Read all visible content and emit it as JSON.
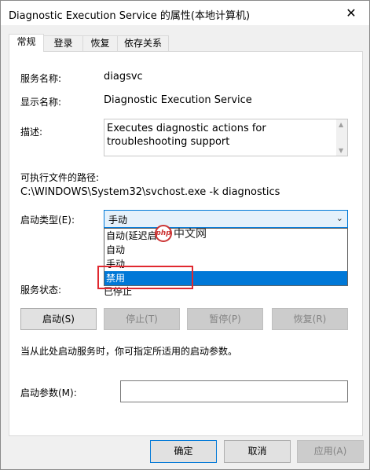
{
  "window": {
    "title": "Diagnostic Execution Service 的属性(本地计算机)",
    "close_glyph": "✕"
  },
  "tabs": [
    {
      "label": "常规",
      "active": true
    },
    {
      "label": "登录",
      "active": false
    },
    {
      "label": "恢复",
      "active": false
    },
    {
      "label": "依存关系",
      "active": false
    }
  ],
  "general": {
    "service_name_label": "服务名称:",
    "service_name_value": "diagsvc",
    "display_name_label": "显示名称:",
    "display_name_value": "Diagnostic Execution Service",
    "description_label": "描述:",
    "description_value": "Executes diagnostic actions for troubleshooting support",
    "path_label": "可执行文件的路径:",
    "path_value": "C:\\WINDOWS\\System32\\svchost.exe -k diagnostics",
    "startup_type_label": "启动类型(E):",
    "startup_type_value": "手动",
    "startup_options": [
      "自动(延迟启动)",
      "自动",
      "手动",
      "禁用"
    ],
    "startup_options_highlighted": "禁用",
    "service_status_label": "服务状态:",
    "service_status_value": "已停止",
    "buttons": {
      "start": "启动(S)",
      "stop": "停止(T)",
      "pause": "暂停(P)",
      "resume": "恢复(R)"
    },
    "hint_text": "当从此处启动服务时，你可指定所适用的启动参数。",
    "start_params_label": "启动参数(M):",
    "start_params_value": ""
  },
  "footer": {
    "ok": "确定",
    "cancel": "取消",
    "apply": "应用(A)"
  },
  "watermark": {
    "logo_text": "php",
    "site_text": "中文网"
  },
  "colors": {
    "accent": "#0078d7",
    "highlight_box": "#e0282f"
  }
}
